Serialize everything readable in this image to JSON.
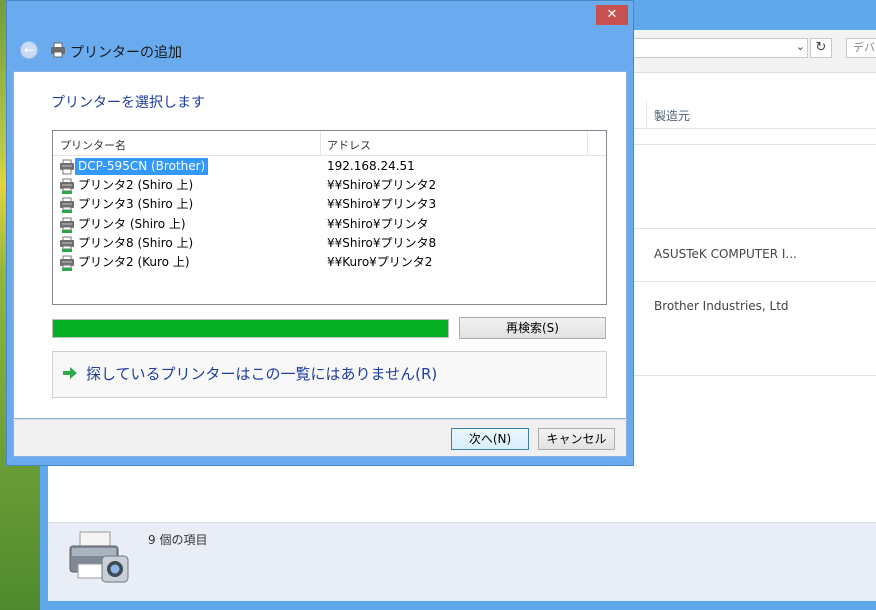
{
  "background_window": {
    "search_placeholder": "デバ",
    "column_header": "製造元",
    "manufacturers": [
      "ASUSTeK COMPUTER I...",
      "Brother Industries, Ltd"
    ],
    "status_text": "9 個の項目"
  },
  "dialog": {
    "title": "プリンターの追加",
    "heading": "プリンターを選択します",
    "columns": {
      "name": "プリンター名",
      "address": "アドレス"
    },
    "printers": [
      {
        "name": "DCP-595CN (Brother)",
        "address": "192.168.24.51"
      },
      {
        "name": "プリンタ2 (Shiro 上)",
        "address": "¥¥Shiro¥プリンタ2"
      },
      {
        "name": "プリンタ3 (Shiro 上)",
        "address": "¥¥Shiro¥プリンタ3"
      },
      {
        "name": "プリンタ (Shiro 上)",
        "address": "¥¥Shiro¥プリンタ"
      },
      {
        "name": "プリンタ8 (Shiro 上)",
        "address": "¥¥Shiro¥プリンタ8"
      },
      {
        "name": "プリンタ2 (Kuro 上)",
        "address": "¥¥Kuro¥プリンタ2"
      }
    ],
    "selected_index": 0,
    "search_progress": 1.0,
    "research_button": "再検索(S)",
    "not_listed_link": "探しているプリンターはこの一覧にはありません(R)",
    "next_button": "次へ(N)",
    "cancel_button": "キャンセル",
    "close_glyph": "✕",
    "back_glyph": "←"
  },
  "colors": {
    "accent_frame": "#6aabf0",
    "heading_text": "#1e3d9e",
    "selection": "#3399ff",
    "progress": "#06b025"
  },
  "icons": [
    "back-arrow-icon",
    "printer-icon",
    "green-arrow-icon",
    "close-icon",
    "devices-printers-icon",
    "refresh-icon",
    "dropdown-chevron-icon"
  ]
}
